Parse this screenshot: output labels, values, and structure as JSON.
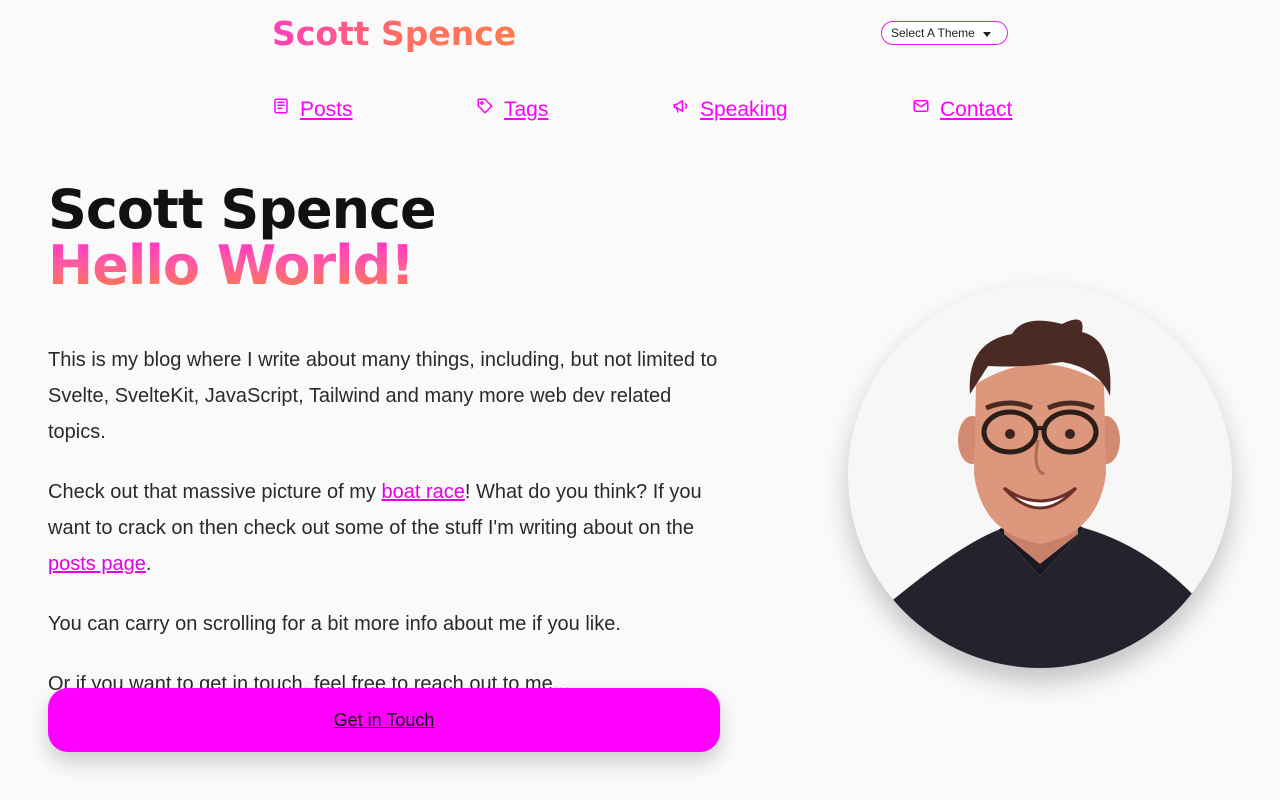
{
  "header": {
    "site_title": "Scott Spence",
    "theme_select": {
      "selected": "Select A Theme"
    }
  },
  "nav": {
    "items": [
      {
        "label": "Posts",
        "icon": "posts-icon"
      },
      {
        "label": "Tags",
        "icon": "tag-icon"
      },
      {
        "label": "Speaking",
        "icon": "megaphone-icon"
      },
      {
        "label": "Contact",
        "icon": "mail-icon"
      }
    ]
  },
  "hero": {
    "name": "Scott Spence",
    "greeting": "Hello World!"
  },
  "content": {
    "p1": "This is my blog where I write about many things, including, but not limited to Svelte, SvelteKit, JavaScript, Tailwind and many more web dev related topics.",
    "p2_before": "Check out that massive picture of my ",
    "p2_link": "boat race",
    "p2_middle": "! What do you think? If you want to crack on then check out some of the stuff I'm writing about on the ",
    "p2_link2": "posts page",
    "p2_after": ".",
    "p3": "You can carry on scrolling for a bit more info about me if you like.",
    "p4": "Or if you want to get in touch, feel free to reach out to me..."
  },
  "cta": {
    "label": "Get in Touch"
  },
  "colors": {
    "accent": "#ff00ff",
    "background": "#fafafa",
    "gradient_start": "#ff33cc",
    "gradient_end": "#ff7a45"
  }
}
